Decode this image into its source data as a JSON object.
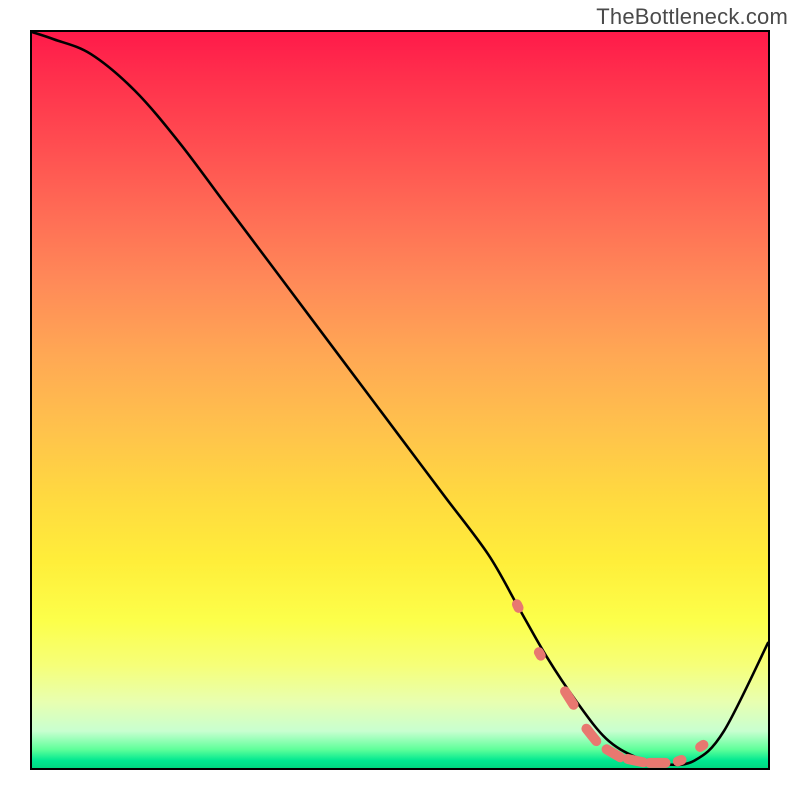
{
  "watermark": "TheBottleneck.com",
  "chart_data": {
    "type": "line",
    "title": "",
    "xlabel": "",
    "ylabel": "",
    "xlim": [
      0,
      100
    ],
    "ylim": [
      0,
      100
    ],
    "grid": false,
    "legend": false,
    "x": [
      0,
      3,
      8,
      14,
      20,
      26,
      32,
      38,
      44,
      50,
      56,
      62,
      66,
      70,
      74,
      78,
      82,
      86,
      90,
      94,
      100
    ],
    "values": [
      100,
      99,
      97,
      92,
      85,
      77,
      69,
      61,
      53,
      45,
      37,
      29,
      22,
      15,
      9,
      4,
      1.5,
      0.5,
      1,
      5,
      17
    ],
    "gradient": {
      "top_color": "#ff1a4a",
      "mid_color": "#ffe640",
      "bottom_color": "#00d880"
    },
    "markers": {
      "color": "#e87870",
      "shape": "rounded-dash",
      "points_x": [
        66,
        69,
        73,
        76,
        79,
        82,
        85,
        88,
        91
      ],
      "points_y": [
        22,
        15.5,
        9.5,
        4.5,
        2,
        1,
        0.7,
        1,
        3
      ]
    }
  }
}
